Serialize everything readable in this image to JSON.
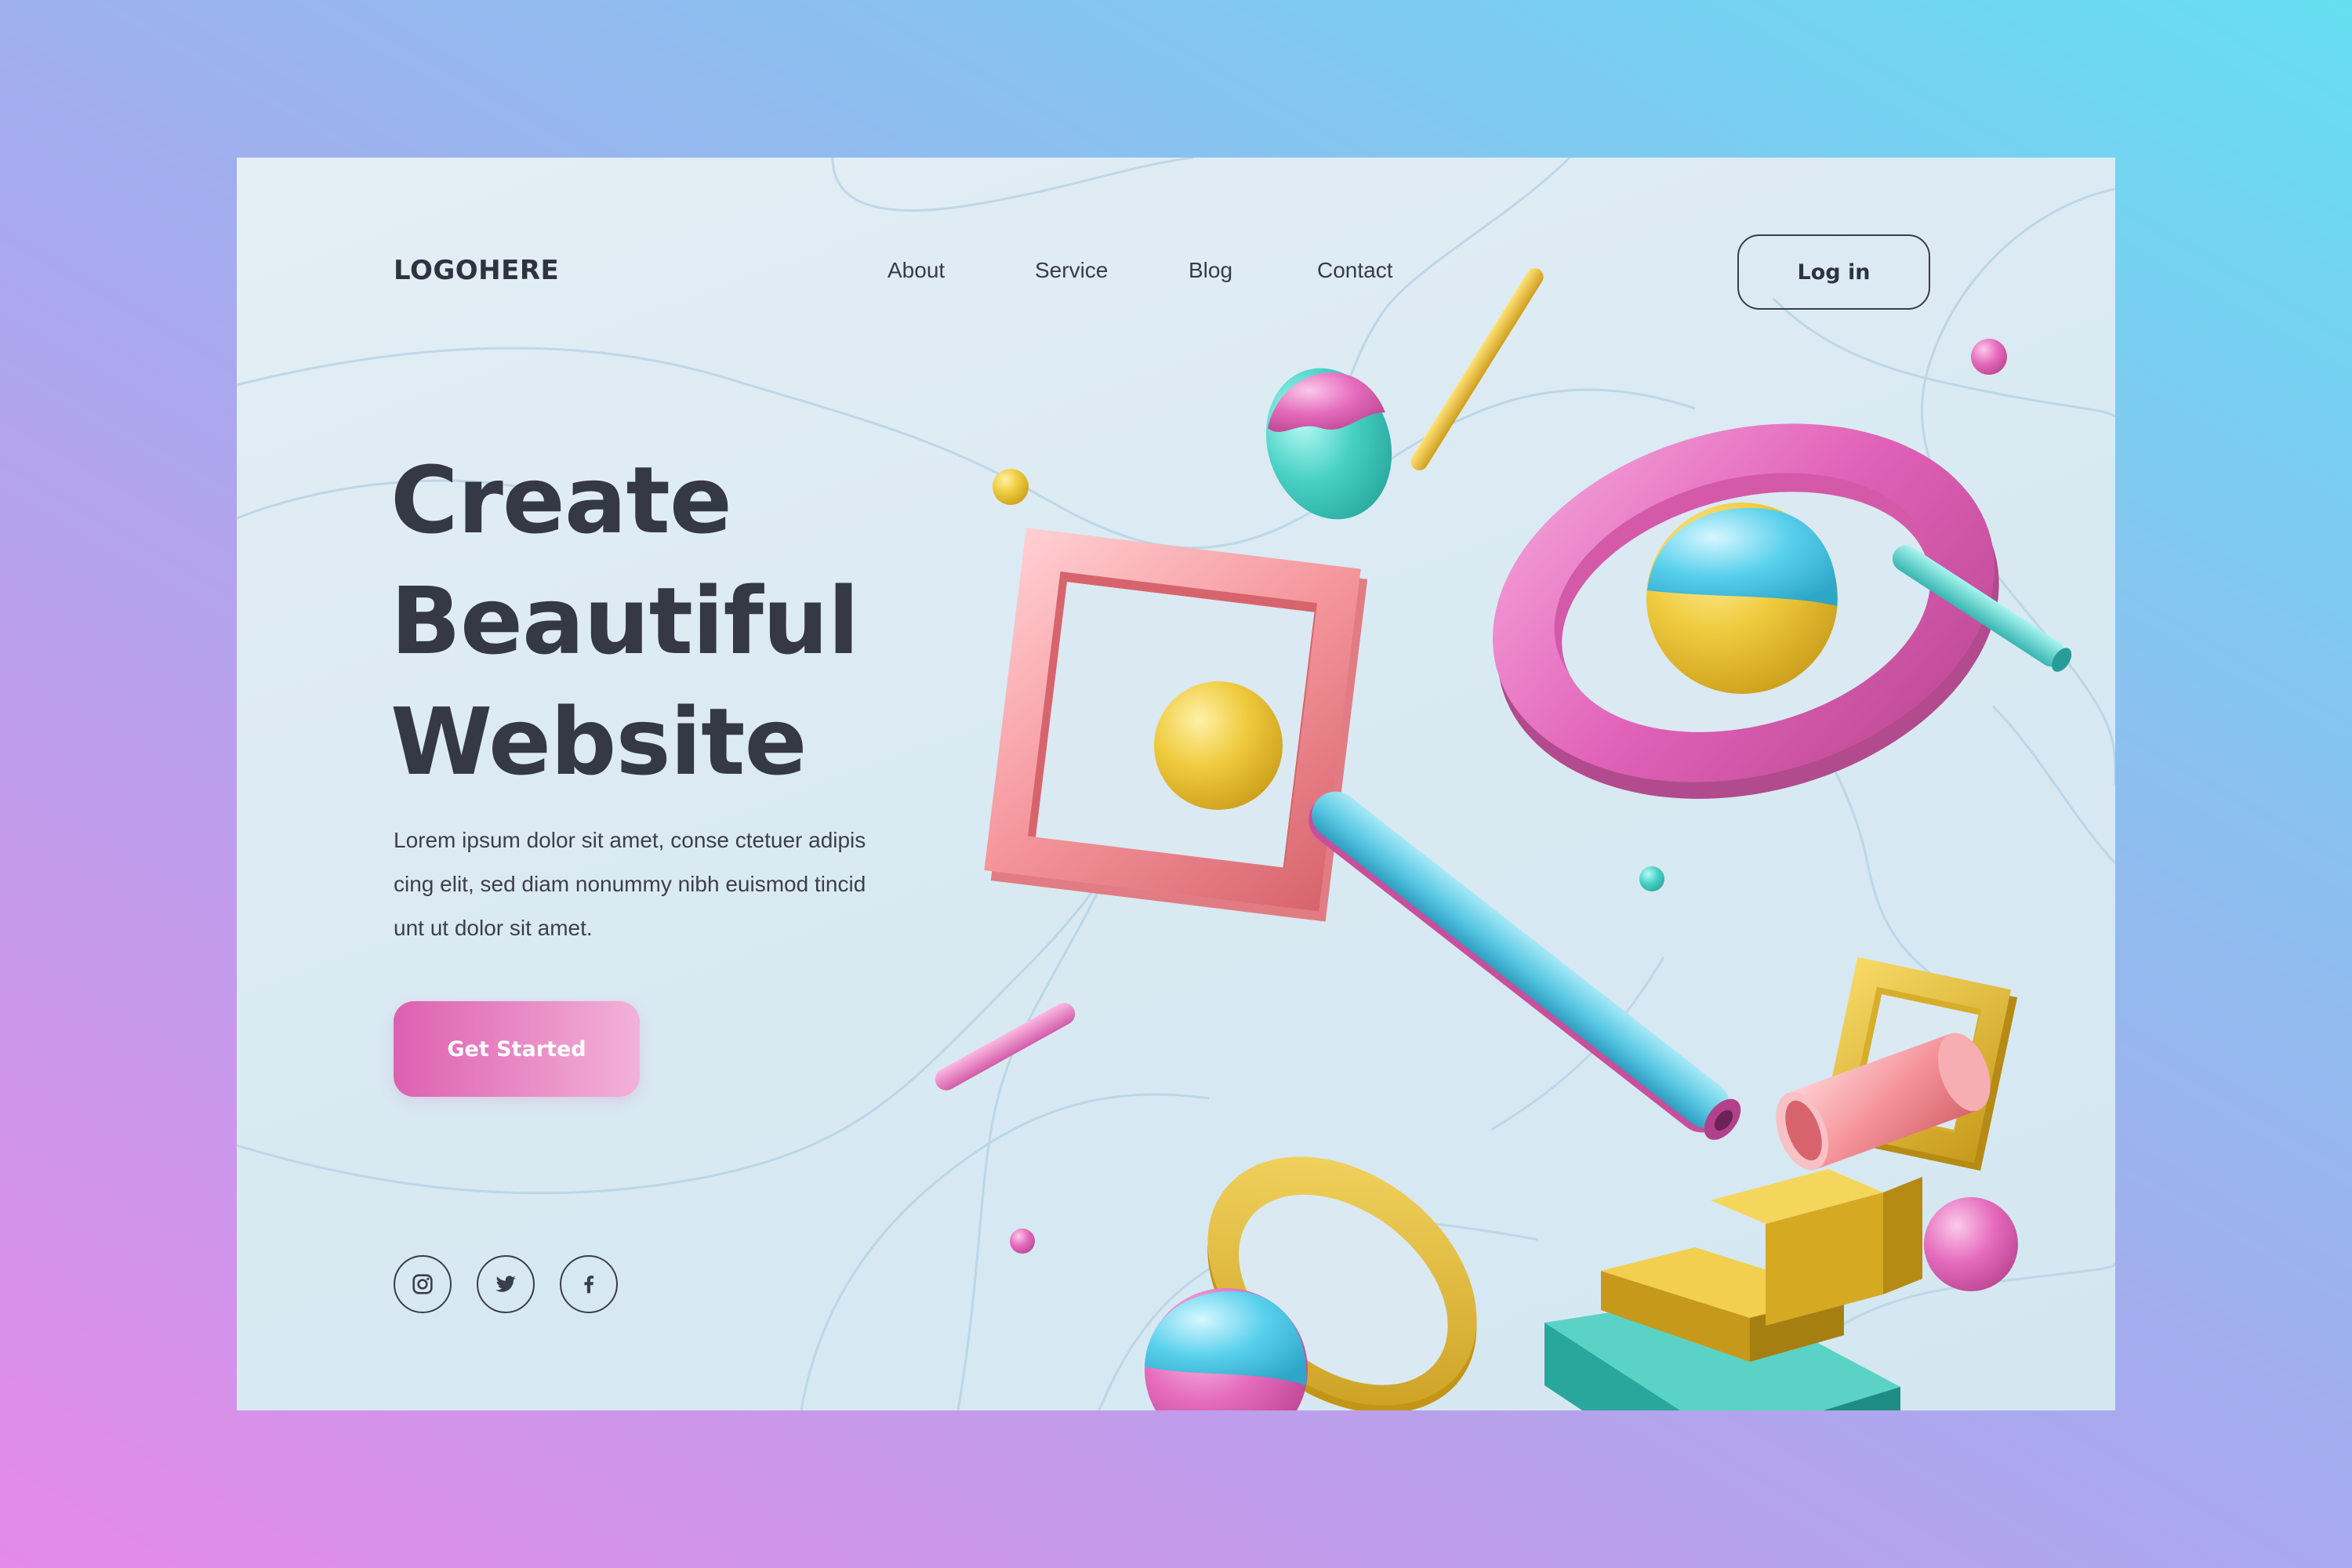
{
  "brand": {
    "logo": "LOGOHERE"
  },
  "nav": {
    "items": [
      "About",
      "Service",
      "Blog",
      "Contact"
    ],
    "login_label": "Log in"
  },
  "hero": {
    "headline": [
      "Create",
      "Beautiful",
      "Website"
    ],
    "description": [
      "Lorem ipsum dolor sit amet, conse ctetuer adipis",
      "cing elit, sed diam nonummy nibh euismod tincid",
      "unt ut dolor sit amet."
    ],
    "cta_label": "Get Started"
  },
  "social": {
    "icons": [
      "instagram-icon",
      "twitter-icon",
      "facebook-icon"
    ]
  },
  "colors": {
    "text_dark": "#353845",
    "accent_pink": "#e06ab8",
    "accent_yellow": "#e8c234",
    "accent_cyan": "#5ccfe4",
    "accent_teal": "#3cbdb0",
    "accent_coral": "#f2939a"
  }
}
